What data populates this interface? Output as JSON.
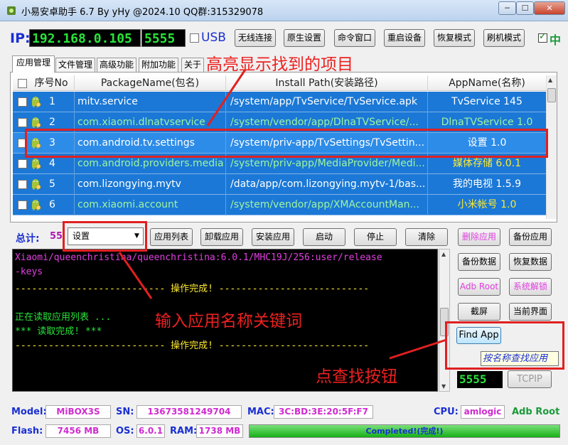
{
  "window": {
    "title": "小易安卓助手 6.7 By yHy @2024.10 QQ群:315329078",
    "min_label": "─",
    "max_label": "☐",
    "close_label": "✕"
  },
  "connection": {
    "ip_label": "IP:",
    "ip": "192.168.0.105",
    "port": "5555",
    "usb_label": "USB",
    "zh_label": "中",
    "zh_tick": "✓"
  },
  "toolbar": [
    {
      "label": "无线连接"
    },
    {
      "label": "原生设置"
    },
    {
      "label": "命令窗口"
    },
    {
      "label": "重启设备"
    },
    {
      "label": "恢复模式"
    },
    {
      "label": "刷机模式"
    }
  ],
  "tabs": [
    {
      "label": "应用管理",
      "active": true
    },
    {
      "label": "文件管理"
    },
    {
      "label": "高级功能"
    },
    {
      "label": "附加功能"
    },
    {
      "label": "关于"
    }
  ],
  "table": {
    "columns": [
      "序号No",
      "PackageName(包名)",
      "Install Path(安装路径)",
      "AppName(名称)"
    ],
    "rows": [
      {
        "no": "1",
        "package": "mitv.service",
        "path": "/system/app/TvService/TvService.apk",
        "name": "TvService 145",
        "pkg_color": "#ffffff",
        "path_color": "#ffffff",
        "name_color": "#ffffff"
      },
      {
        "no": "2",
        "package": "com.xiaomi.dlnatvservice",
        "path": "/system/vendor/app/DlnaTVService/...",
        "name": "DlnaTVService 1.0",
        "pkg_color": "#9ff59f",
        "path_color": "#9ff59f",
        "name_color": "#9ff59f"
      },
      {
        "no": "3",
        "package": "com.android.tv.settings",
        "path": "/system/priv-app/TvSettings/TvSettin...",
        "name": "设置 1.0",
        "pkg_color": "#ffffff",
        "path_color": "#ffffff",
        "name_color": "#ffffff",
        "selected": true
      },
      {
        "no": "4",
        "package": "com.android.providers.media",
        "path": "/system/priv-app/MediaProvider/Medi...",
        "name": "媒体存储 6.0.1",
        "pkg_color": "#9ff59f",
        "path_color": "#9ff59f",
        "name_color": "#ffea30"
      },
      {
        "no": "5",
        "package": "com.lizongying.mytv",
        "path": "/data/app/com.lizongying.mytv-1/bas...",
        "name": "我的电视 1.5.9",
        "pkg_color": "#ffffff",
        "path_color": "#ffffff",
        "name_color": "#ffffff"
      },
      {
        "no": "6",
        "package": "com.xiaomi.account",
        "path": "/system/vendor/app/XMAccountMan...",
        "name": "小米帐号 1.0",
        "pkg_color": "#9ff59f",
        "path_color": "#9ff59f",
        "name_color": "#ffea30"
      }
    ]
  },
  "controls": {
    "total_label": "总计:",
    "total_value": "55",
    "select_value": "设置",
    "buttons": [
      {
        "label": "应用列表"
      },
      {
        "label": "卸载应用"
      },
      {
        "label": "安装应用"
      },
      {
        "label": "启动"
      },
      {
        "label": "停止"
      },
      {
        "label": "清除"
      }
    ]
  },
  "console": {
    "lines": [
      {
        "text": "Xiaomi/queenchristina/queenchristina:6.0.1/MHC19J/256:user/release",
        "color": "#e040e0"
      },
      {
        "text": "-keys",
        "color": "#e040e0"
      },
      {
        "text": "--------------------------- 操作完成! ---------------------------",
        "color": "#ffea30"
      },
      {
        "text": "",
        "color": "#ffffff"
      },
      {
        "text": "正在读取应用列表 ...",
        "color": "#28e43a"
      },
      {
        "text": "*** 读取完成! ***",
        "color": "#28e43a"
      },
      {
        "text": "--------------------------- 操作完成! ---------------------------",
        "color": "#ffea30"
      }
    ]
  },
  "side_buttons": [
    {
      "label": "删除应用",
      "color": "#e040e0"
    },
    {
      "label": "备份应用",
      "color": "#000000"
    },
    {
      "label": "备份数据",
      "color": "#000000"
    },
    {
      "label": "恢复数据",
      "color": "#000000"
    },
    {
      "label": "Adb Root",
      "color": "#e040e0"
    },
    {
      "label": "系统解锁",
      "color": "#e040e0"
    },
    {
      "label": "截屏",
      "color": "#000000"
    },
    {
      "label": "当前界面",
      "color": "#000000"
    }
  ],
  "find": {
    "button": "Find App",
    "tooltip": "按名称查找应用",
    "tcpip_port": "5555",
    "tcpip_button": "TCPIP"
  },
  "device": {
    "model_label": "Model:",
    "model": "MiBOX3S",
    "sn_label": "SN:",
    "sn": "13673581249704",
    "mac_label": "MAC:",
    "mac": "3C:BD:3E:20:5F:F7",
    "cpu_label": "CPU:",
    "cpu": "amlogic",
    "root_status": "Adb Root",
    "flash_label": "Flash:",
    "flash": "7456 MB",
    "os_label": "OS:",
    "os": "6.0.1",
    "ram_label": "RAM:",
    "ram": "1738 MB",
    "progress_text": "Completed!(完成!)",
    "progress_fraction": 1.0
  },
  "annotations": {
    "highlight": "高亮显示找到的项目",
    "input": "输入应用名称关键词",
    "click": "点查找按钮"
  },
  "colors": {
    "row_bg": "#1b78d6",
    "annotation_red": "#e02020"
  }
}
